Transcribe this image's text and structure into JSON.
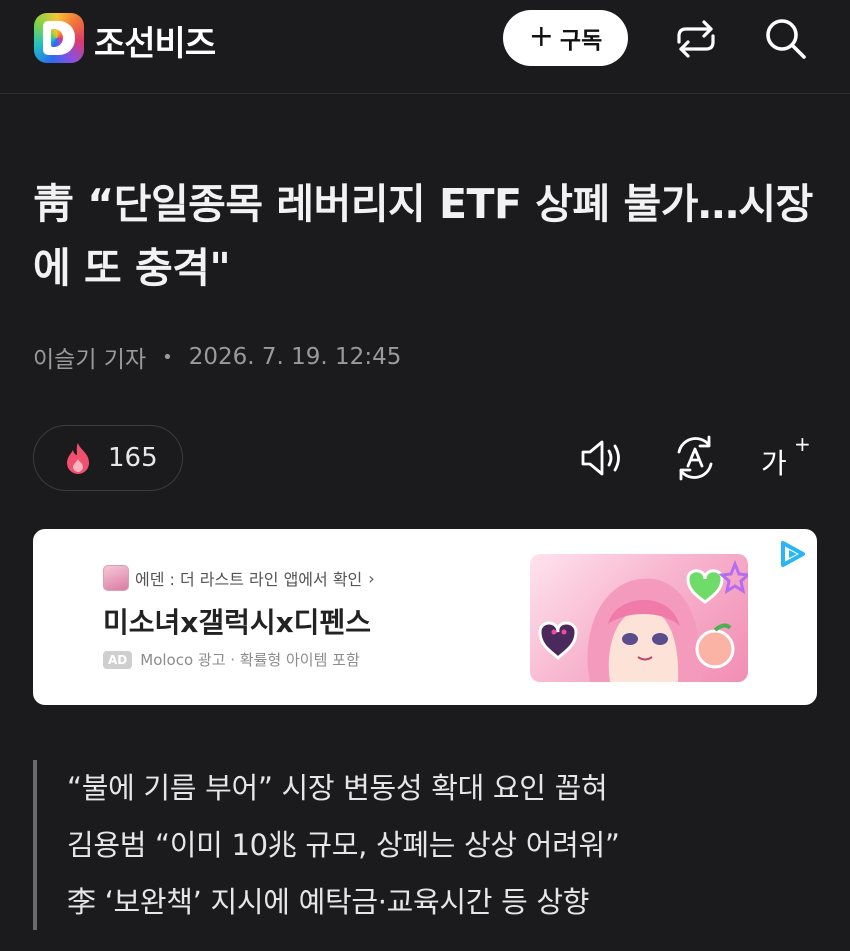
{
  "header": {
    "logo_letter": "D",
    "brand_name": "조선비즈",
    "subscribe_label": "구독",
    "subscribe_icon": "plus-icon",
    "share_icon": "share-icon",
    "search_icon": "search-icon"
  },
  "article": {
    "title": "靑 “단일종목 레버리지 ETF 상폐 불가…시장에 또 충격\"",
    "author": "이슬기 기자",
    "date": "2026. 7. 19. 12:45",
    "like_count": "165",
    "tools": {
      "listen_icon": "speaker-icon",
      "translate_icon": "auto-translate-icon",
      "font_size_label": "가"
    },
    "summary": [
      "“불에 기름 부어” 시장 변동성 확대 요인 꼽혀",
      "김용범 “이미 10兆 규모, 상폐는 상상 어려워”",
      "李 ‘보완책’ 지시에 예탁금·교육시간 등 상향"
    ]
  },
  "ad": {
    "source": "에덴 : 더 라스트 라인 앱에서 확인",
    "source_chevron": "›",
    "headline": "미소녀x갤럭시x디펜스",
    "badge": "AD",
    "meta": "Moloco 광고 · 확률형 아이템 포함"
  },
  "colors": {
    "background": "#1b1b1e",
    "text": "#ececec",
    "muted": "#9a9a9e",
    "like_flame": "#f0506e",
    "ad_choice": "#29b6f6"
  }
}
